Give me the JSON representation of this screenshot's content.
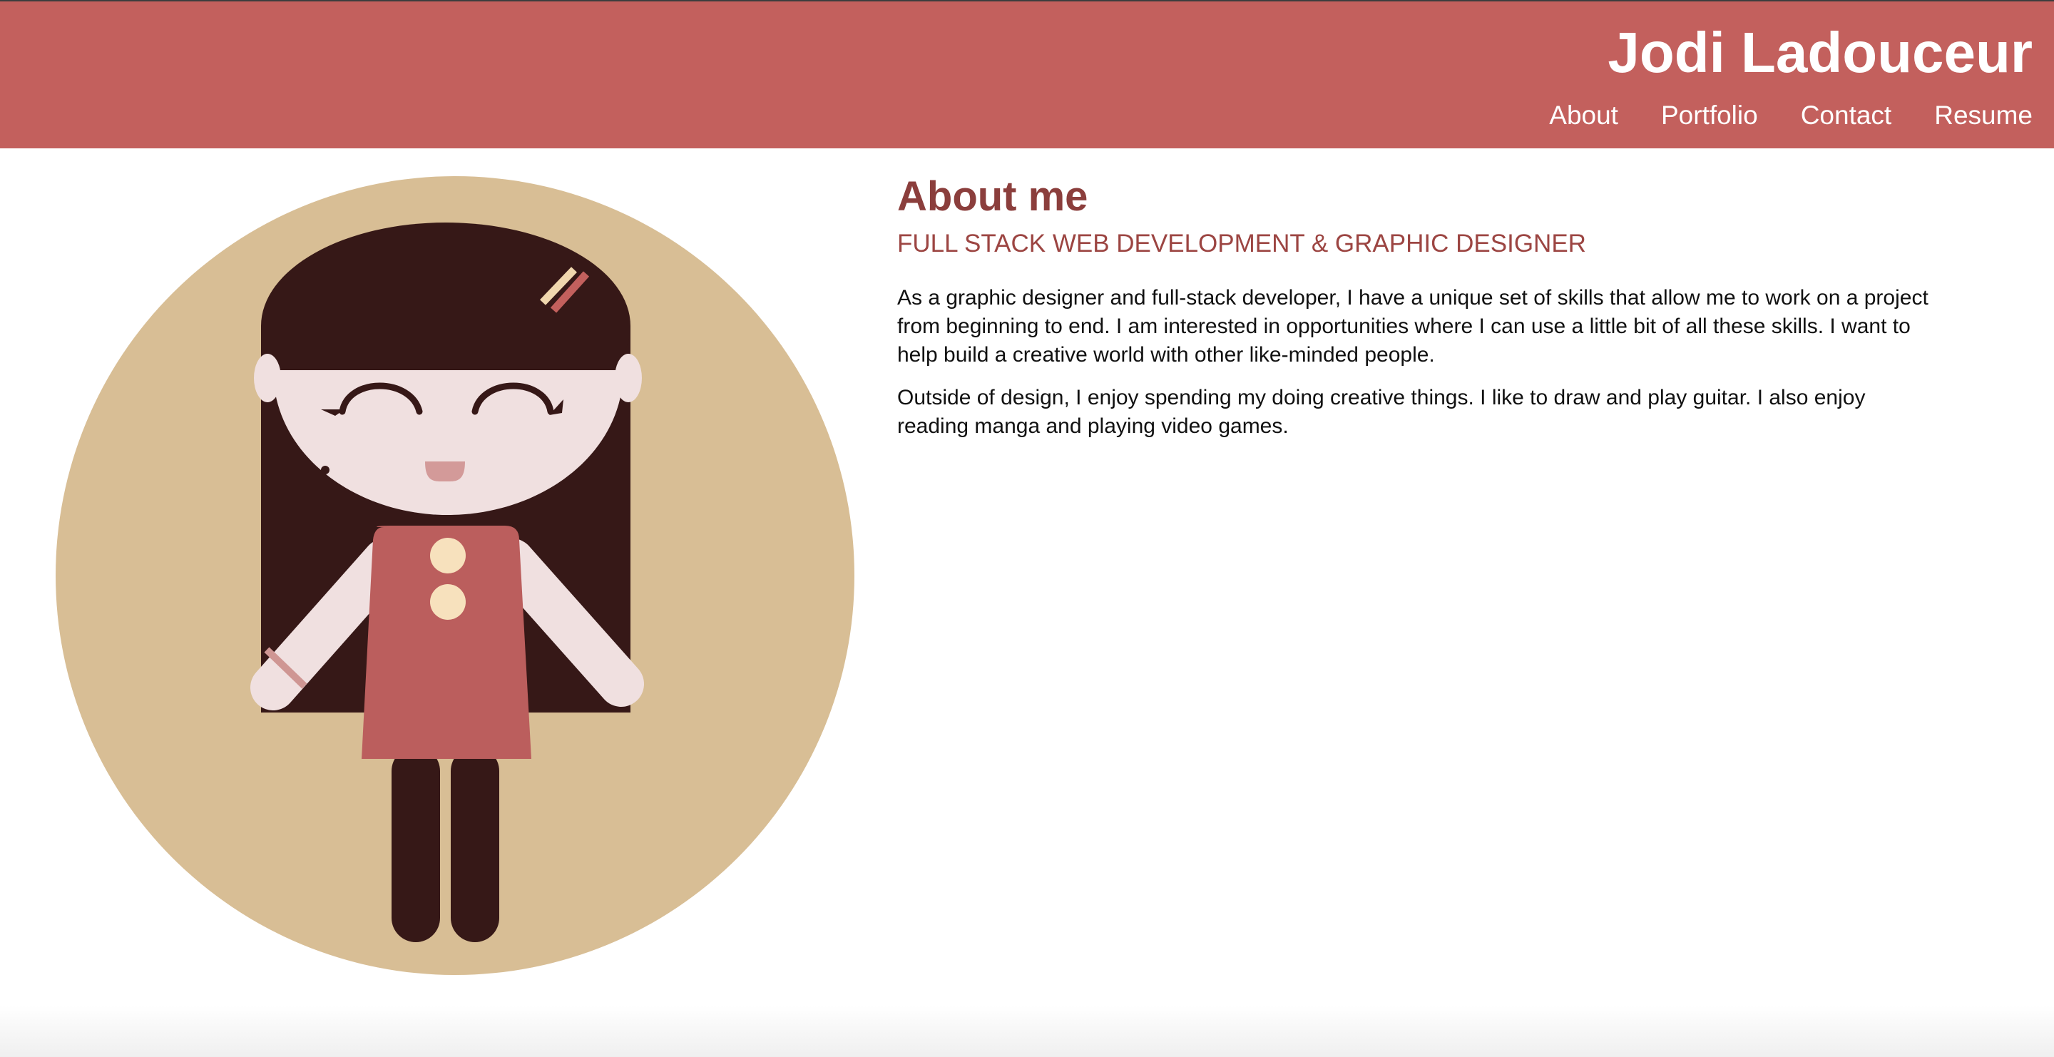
{
  "header": {
    "title": "Jodi Ladouceur",
    "nav": [
      "About",
      "Portfolio",
      "Contact",
      "Resume"
    ]
  },
  "about": {
    "heading": "About me",
    "subheading": "FULL STACK WEB DEVELOPMENT & GRAPHIC DESIGNER",
    "paragraphs": [
      "As a graphic designer and full-stack developer, I have a unique set of skills that allow me to work on a project from beginning to end. I am interested in opportunities where I can use a little bit of all these skills. I want to help build a creative world with other like-minded people.",
      "Outside of design, I enjoy spending my doing creative things. I like to draw and play guitar. I also enjoy reading manga and playing video games."
    ]
  },
  "colors": {
    "header_bg": "#c3605d",
    "accent_text": "#8b3e3c",
    "avatar_bg": "#d8be95",
    "hair": "#361817",
    "skin": "#f0e0e0",
    "dress": "#bb5e5d",
    "button": "#f7e1bd"
  },
  "avatar": {
    "icon": "girl-illustration-icon"
  }
}
